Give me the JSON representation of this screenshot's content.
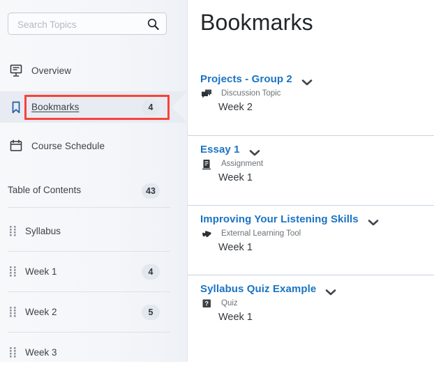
{
  "sidebar": {
    "search": {
      "placeholder": "Search Topics",
      "value": "",
      "icon": "search-icon"
    },
    "nav": [
      {
        "label": "Overview",
        "icon": "presentation-icon",
        "badge": "",
        "selected": false
      },
      {
        "label": "Bookmarks",
        "icon": "bookmark-flag-icon",
        "badge": "4",
        "selected": true
      },
      {
        "label": "Course Schedule",
        "icon": "calendar-icon",
        "badge": "",
        "selected": false
      }
    ],
    "toc": {
      "title": "Table of Contents",
      "badge": "43",
      "items": [
        {
          "label": "Syllabus",
          "badge": "",
          "handle": "drag-handle-icon"
        },
        {
          "label": "Week 1",
          "badge": "4",
          "handle": "drag-handle-icon"
        },
        {
          "label": "Week 2",
          "badge": "5",
          "handle": "drag-handle-icon"
        },
        {
          "label": "Week 3",
          "badge": "",
          "handle": "drag-handle-icon"
        }
      ]
    }
  },
  "main": {
    "title": "Bookmarks",
    "bookmarks": [
      {
        "title": "Projects - Group 2",
        "type": "Discussion Topic",
        "type_icon": "discussion-icon",
        "week": "Week 2",
        "chevron": "chevron-down-icon"
      },
      {
        "title": "Essay 1",
        "type": "Assignment",
        "type_icon": "assignment-icon",
        "week": "Week 1",
        "chevron": "chevron-down-icon"
      },
      {
        "title": "Improving Your Listening Skills",
        "type": "External Learning Tool",
        "type_icon": "puzzle-piece-icon",
        "week": "Week 1",
        "chevron": "chevron-down-icon"
      },
      {
        "title": "Syllabus Quiz Example",
        "type": "Quiz",
        "type_icon": "quiz-question-icon",
        "week": "Week 1",
        "chevron": "chevron-down-icon"
      }
    ]
  },
  "annotation": {
    "highlight_color": "#f9423a",
    "target": "Bookmarks"
  },
  "colors": {
    "link_blue": "#1a73c4",
    "sidebar_bg": "#f4f6f9",
    "selected_row": "#e8ebf1",
    "badge_bg": "#e3e8ef",
    "divider": "#dde2e9"
  }
}
